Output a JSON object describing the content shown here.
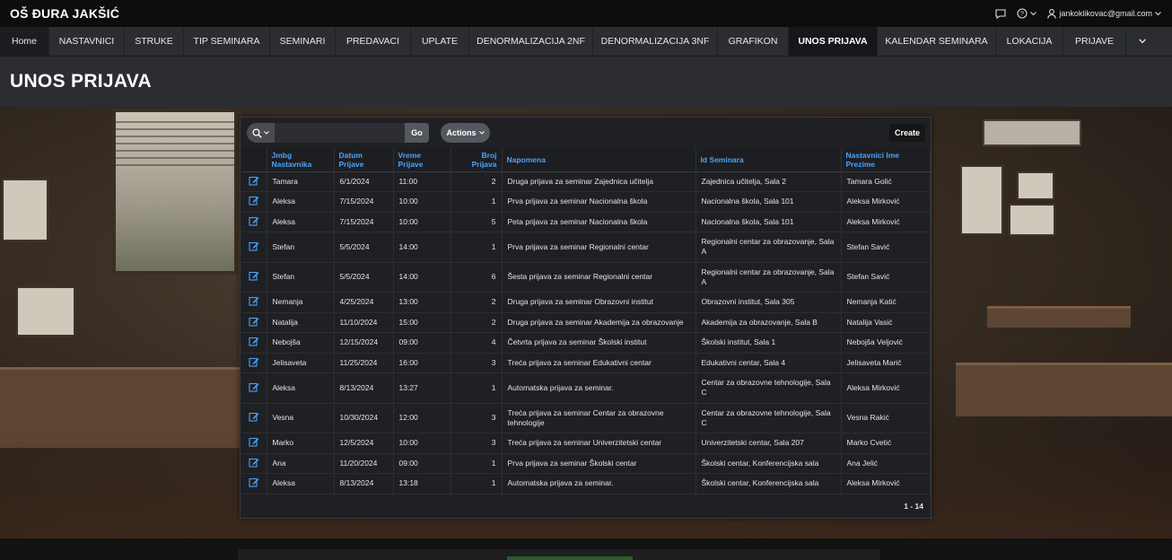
{
  "app": {
    "title": "OŠ ĐURA JAKŠIĆ"
  },
  "topbar": {
    "user_email": "jankoklikovac@gmail.com"
  },
  "nav": {
    "items": [
      {
        "label": "Home"
      },
      {
        "label": "NASTAVNICI"
      },
      {
        "label": "STRUKE"
      },
      {
        "label": "TIP SEMINARA"
      },
      {
        "label": "SEMINARI"
      },
      {
        "label": "PREDAVACI"
      },
      {
        "label": "UPLATE"
      },
      {
        "label": "DENORMALIZACIJA 2NF"
      },
      {
        "label": "DENORMALIZACIJA 3NF"
      },
      {
        "label": "GRAFIKON"
      },
      {
        "label": "UNOS PRIJAVA"
      },
      {
        "label": "KALENDAR SEMINARA"
      },
      {
        "label": "LOKACIJA"
      },
      {
        "label": "PRIJAVE"
      }
    ],
    "active": "UNOS PRIJAVA"
  },
  "page": {
    "title": "UNOS PRIJAVA"
  },
  "toolbar": {
    "search_value": "",
    "go_label": "Go",
    "actions_label": "Actions",
    "create_label": "Create"
  },
  "grid": {
    "columns": {
      "jmbg_1": "Jmbg",
      "jmbg_2": "Nastavnika",
      "datum_1": "Datum",
      "datum_2": "Prijave",
      "vreme_1": "Vreme",
      "vreme_2": "Prijave",
      "broj_1": "Broj",
      "broj_2": "Prijava",
      "napomena": "Napomena",
      "seminar": "Id Seminara",
      "ime_1": "Nastavnici Ime",
      "ime_2": "Prezime"
    },
    "rows": [
      {
        "jmbg": "Tamara",
        "datum": "6/1/2024",
        "vreme": "11:00",
        "broj": "2",
        "napomena": "Druga prijava za seminar Zajednica učitelja",
        "seminar": "Zajednica učitelja, Sala 2",
        "ime": "Tamara Golić"
      },
      {
        "jmbg": "Aleksa",
        "datum": "7/15/2024",
        "vreme": "10:00",
        "broj": "1",
        "napomena": "Prva prijava za seminar Nacionalna škola",
        "seminar": "Nacionalna škola, Sala 101",
        "ime": "Aleksa Mirković"
      },
      {
        "jmbg": "Aleksa",
        "datum": "7/15/2024",
        "vreme": "10:00",
        "broj": "5",
        "napomena": "Peta prijava za seminar Nacionalna škola",
        "seminar": "Nacionalna škola, Sala 101",
        "ime": "Aleksa Mirković"
      },
      {
        "jmbg": "Stefan",
        "datum": "5/5/2024",
        "vreme": "14:00",
        "broj": "1",
        "napomena": "Prva prijava za seminar Regionalni centar",
        "seminar": "Regionalni centar za obrazovanje, Sala A",
        "ime": "Stefan Savić"
      },
      {
        "jmbg": "Stefan",
        "datum": "5/5/2024",
        "vreme": "14:00",
        "broj": "6",
        "napomena": "Šesta prijava za seminar Regionalni centar",
        "seminar": "Regionalni centar za obrazovanje, Sala A",
        "ime": "Stefan Savić"
      },
      {
        "jmbg": "Nemanja",
        "datum": "4/25/2024",
        "vreme": "13:00",
        "broj": "2",
        "napomena": "Druga prijava za seminar Obrazovni institut",
        "seminar": "Obrazovni institut, Sala 305",
        "ime": "Nemanja Katić"
      },
      {
        "jmbg": "Natalija",
        "datum": "11/10/2024",
        "vreme": "15:00",
        "broj": "2",
        "napomena": "Druga prijava za seminar Akademija za obrazovanje",
        "seminar": "Akademija za obrazovanje, Sala B",
        "ime": "Natalija Vasić"
      },
      {
        "jmbg": "Nebojša",
        "datum": "12/15/2024",
        "vreme": "09:00",
        "broj": "4",
        "napomena": "Četvrta prijava za seminar Školski institut",
        "seminar": "Školski institut, Sala 1",
        "ime": "Nebojša Veljović"
      },
      {
        "jmbg": "Jelisaveta",
        "datum": "11/25/2024",
        "vreme": "16:00",
        "broj": "3",
        "napomena": "Treća prijava za seminar Edukativni centar",
        "seminar": "Edukativni centar, Sala 4",
        "ime": "Jelisaveta Marić"
      },
      {
        "jmbg": "Aleksa",
        "datum": "8/13/2024",
        "vreme": "13:27",
        "broj": "1",
        "napomena": "Automatska prijava za seminar.",
        "seminar": "Centar za obrazovne tehnologije, Sala C",
        "ime": "Aleksa Mirković"
      },
      {
        "jmbg": "Vesna",
        "datum": "10/30/2024",
        "vreme": "12:00",
        "broj": "3",
        "napomena": "Treća prijava za seminar Centar za obrazovne tehnologije",
        "seminar": "Centar za obrazovne tehnologije, Sala C",
        "ime": "Vesna Rakić"
      },
      {
        "jmbg": "Marko",
        "datum": "12/5/2024",
        "vreme": "10:00",
        "broj": "3",
        "napomena": "Treća prijava za seminar Univerzitetski centar",
        "seminar": "Univerzitetski centar, Sala 207",
        "ime": "Marko Cvetić"
      },
      {
        "jmbg": "Ana",
        "datum": "11/20/2024",
        "vreme": "09:00",
        "broj": "1",
        "napomena": "Prva prijava za seminar Školski centar",
        "seminar": "Školski centar, Konferencijska sala",
        "ime": "Ana Jelić"
      },
      {
        "jmbg": "Aleksa",
        "datum": "8/13/2024",
        "vreme": "13:18",
        "broj": "1",
        "napomena": "Automatska prijava za seminar.",
        "seminar": "Školski centar, Konferencijska sala",
        "ime": "Aleksa Mirković"
      }
    ],
    "pagination": "1 - 14"
  },
  "colors": {
    "accent_link": "#4aa3ff",
    "topbar": "#0d0d0d",
    "nav": "#2b2d31",
    "panel": "#1f2023"
  },
  "icons": [
    "chat-icon",
    "help-icon",
    "user-icon",
    "chevron-down-icon",
    "search-icon",
    "edit-icon"
  ]
}
